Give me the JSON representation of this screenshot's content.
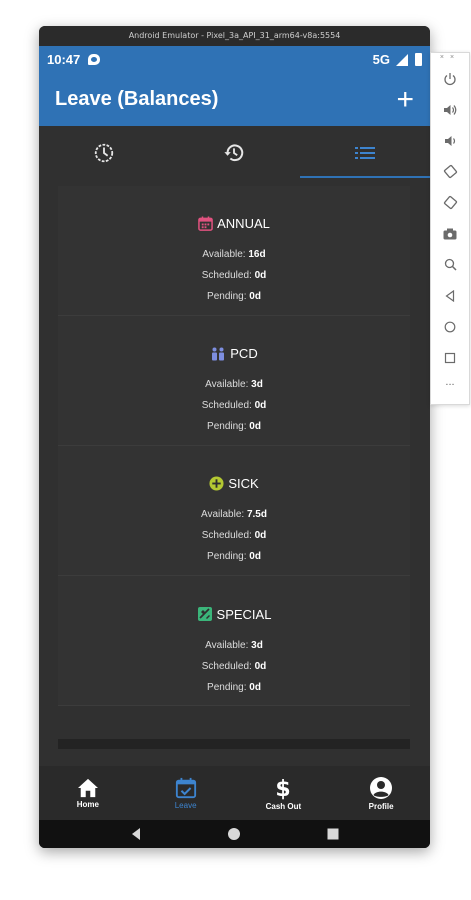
{
  "window": {
    "title": "Android Emulator - Pixel_3a_API_31_arm64-v8a:5554"
  },
  "status_bar": {
    "time": "10:47",
    "network": "5G"
  },
  "app_bar": {
    "title": "Leave (Balances)",
    "add_label": "+"
  },
  "tabs": [
    {
      "icon": "clock-icon",
      "active": false
    },
    {
      "icon": "history-icon",
      "active": false
    },
    {
      "icon": "list-icon",
      "active": true
    }
  ],
  "balances": [
    {
      "name": "ANNUAL",
      "icon": "calendar-icon",
      "icon_color": "#e0527f",
      "available_label": "Available:",
      "available": "16d",
      "scheduled_label": "Scheduled:",
      "scheduled": "0d",
      "pending_label": "Pending:",
      "pending": "0d"
    },
    {
      "name": "PCD",
      "icon": "people-icon",
      "icon_color": "#7d8ee0",
      "available_label": "Available:",
      "available": "3d",
      "scheduled_label": "Scheduled:",
      "scheduled": "0d",
      "pending_label": "Pending:",
      "pending": "0d"
    },
    {
      "name": "SICK",
      "icon": "plus-circle-icon",
      "icon_color": "#b4c832",
      "available_label": "Available:",
      "available": "7.5d",
      "scheduled_label": "Scheduled:",
      "scheduled": "0d",
      "pending_label": "Pending:",
      "pending": "0d"
    },
    {
      "name": "SPECIAL",
      "icon": "special-icon",
      "icon_color": "#3bb57a",
      "available_label": "Available:",
      "available": "3d",
      "scheduled_label": "Scheduled:",
      "scheduled": "0d",
      "pending_label": "Pending:",
      "pending": "0d"
    }
  ],
  "bottom_nav": [
    {
      "label": "Home",
      "icon": "home-icon",
      "active": false
    },
    {
      "label": "Leave",
      "icon": "calendar-check-icon",
      "active": true
    },
    {
      "label": "Cash Out",
      "icon": "dollar-icon",
      "active": false
    },
    {
      "label": "Profile",
      "icon": "account-circle-icon",
      "active": false
    }
  ],
  "side_toolbar": {
    "tools": [
      "power-icon",
      "volume-up-icon",
      "volume-down-icon",
      "rotate-left-icon",
      "rotate-right-icon",
      "camera-icon",
      "zoom-icon",
      "back-icon",
      "home-circle-icon",
      "overview-icon",
      "more-icon"
    ],
    "more_label": "..."
  },
  "colors": {
    "accent": "#2f72b5",
    "background": "#303030",
    "active_nav": "#3d84cf"
  }
}
